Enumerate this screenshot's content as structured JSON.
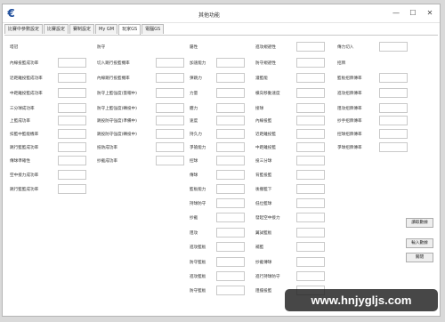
{
  "window": {
    "title": "其他功能",
    "icon": "app-logo-icon",
    "minimize": "—",
    "maximize": "☐",
    "close": "✕"
  },
  "tabs": [
    {
      "label": "比賽中參數設定"
    },
    {
      "label": "比賽設定"
    },
    {
      "label": "賽制設定"
    },
    {
      "label": "My GM"
    },
    {
      "label": "玩家GS"
    },
    {
      "label": "電腦GS"
    }
  ],
  "active_tab": "玩家GS",
  "col1": [
    "塔冠",
    "內線投籃成功率",
    "近距離投籃成功率",
    "中距離投籃成功率",
    "三分球成功率",
    "上籃成功率",
    "扣籃中籃能機率",
    "跳行籃籃成功率",
    "傳球準確性",
    "空中接力成功率",
    "跳行籃籃成功率"
  ],
  "col2": [
    "防守",
    "切入跳行投籃機率",
    "內線跳行投籃機率",
    "防守上籃強度(蓋帽中)",
    "防守上籃強度(轉投中)",
    "跳投防守強度(準備中)",
    "跳投防守強度(轉投中)",
    "抵防成功率",
    "抄截成功率"
  ],
  "col3": [
    "屬性",
    "加速能力",
    "彈跳力",
    "力量",
    "體力",
    "速度",
    "持久力",
    "爭搶能力",
    "控球",
    "傳球",
    "籃板能力",
    "持球防守",
    "抄截",
    "阻攻",
    "進攻籃板",
    "防守籃板",
    "進攻籃板",
    "防守籃板"
  ],
  "col4": [
    "進攻規避性",
    "防守規避性",
    "灌籃能",
    "橫向移動速度",
    "接球",
    "內線投籃",
    "近距離投籃",
    "中距離投籃",
    "投三分球",
    "背籃投籃",
    "後撤籃下",
    "低位籃球",
    "發起空中接力",
    "翼試籃板",
    "補籃",
    "抄截傳球",
    "進行持球防守",
    "阻擋投籃"
  ],
  "col5": [
    "傳力切入",
    "招牌",
    "籃板招牌傳率",
    "進攻招牌傳率",
    "阻攻招牌傳率",
    "抄手招牌傳率",
    "控球招牌傳率",
    "爭球招牌傳率"
  ],
  "buttons": {
    "read": "讀取數據",
    "write": "輸入數據",
    "close": "關閉"
  },
  "watermark": "www.hnjygljs.com"
}
